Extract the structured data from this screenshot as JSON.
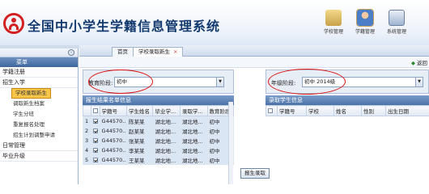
{
  "app": {
    "title": "全国中小学生学籍信息管理系统"
  },
  "header_icons": [
    {
      "label": "学校管理",
      "name": "school-management-icon",
      "color": "#c7a24a"
    },
    {
      "label": "学籍管理",
      "name": "student-status-icon",
      "color": "#4a7fc7"
    },
    {
      "label": "系统管理",
      "name": "system-management-icon",
      "color": "#5a8f5a"
    }
  ],
  "sidebar": {
    "title": "菜单",
    "items": [
      {
        "label": "学籍注册",
        "type": "group"
      },
      {
        "label": "招生入学",
        "type": "group"
      },
      {
        "label": "学校录取新生",
        "type": "sub",
        "active": true
      },
      {
        "label": "调取新生档案",
        "type": "sub"
      },
      {
        "label": "学生分班",
        "type": "sub"
      },
      {
        "label": "重复报名处理",
        "type": "sub"
      },
      {
        "label": "招生计划调整申请",
        "type": "sub"
      },
      {
        "label": "日常管理",
        "type": "group"
      },
      {
        "label": "毕业升级",
        "type": "group"
      }
    ]
  },
  "tabs": [
    {
      "label": "首页"
    },
    {
      "label": "学校录取新生",
      "close": "×"
    }
  ],
  "toolbar": {
    "back_label": "返回"
  },
  "left_panel": {
    "filter_label": "教育阶段:",
    "filter_value": "初中",
    "grid_title": "报生结果名单信息",
    "columns": [
      "",
      "",
      "学籍号",
      "学生姓名",
      "毕业学...",
      "录取学...",
      "教育阶段"
    ],
    "rows": [
      {
        "no": "1",
        "checked": true,
        "id": "G44570...",
        "name": "陈某某",
        "grad": "湖北地...",
        "admit": "湖北地...",
        "stage": "初中"
      },
      {
        "no": "2",
        "checked": true,
        "id": "G44570...",
        "name": "赵某某",
        "grad": "湖北地...",
        "admit": "湖北地...",
        "stage": "初中"
      },
      {
        "no": "3",
        "checked": true,
        "id": "G44570...",
        "name": "张某某",
        "grad": "湖北地...",
        "admit": "湖北地...",
        "stage": "初中"
      },
      {
        "no": "4",
        "checked": true,
        "id": "G44570...",
        "name": "李某某",
        "grad": "湖北地...",
        "admit": "湖北地...",
        "stage": "初中"
      },
      {
        "no": "5",
        "checked": true,
        "id": "G44570...",
        "name": "王某某",
        "grad": "湖北地...",
        "admit": "湖北地...",
        "stage": "初中"
      }
    ]
  },
  "right_panel": {
    "filter_label": "年级阶段:",
    "filter_value": "初中 2014级",
    "grid_title": "录取学生信息",
    "columns": [
      "",
      "学籍号",
      "学校",
      "姓名",
      "性别",
      "出生日期"
    ]
  },
  "actions": {
    "recommend_label": "报生录取"
  }
}
